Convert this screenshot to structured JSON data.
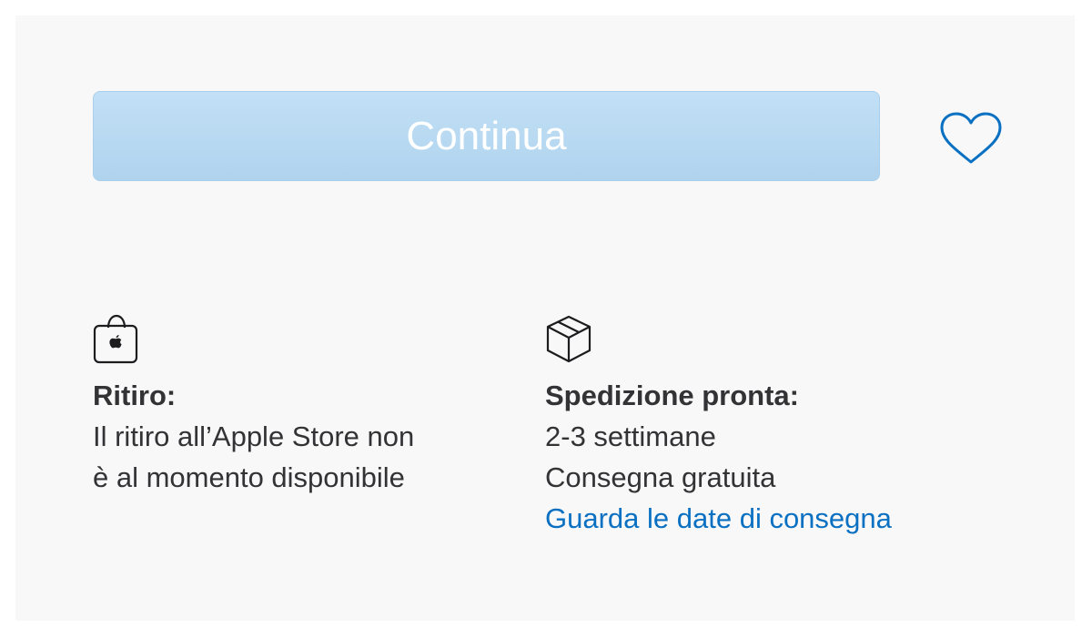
{
  "buy_panel": {
    "continue_label": "Continua",
    "favorite_icon": "heart-outline-icon",
    "accent_color": "#0a70c2",
    "button_color": "#b5d7f1"
  },
  "pickup": {
    "icon": "apple-store-bag-icon",
    "title": "Ritiro:",
    "line1": "Il ritiro all’Apple Store non",
    "line2": "è al momento disponibile"
  },
  "shipping": {
    "icon": "package-box-icon",
    "title": "Spedizione pronta:",
    "line1": "2-3 settimane",
    "line2": "Consegna gratuita",
    "link": "Guarda le date di consegna"
  }
}
